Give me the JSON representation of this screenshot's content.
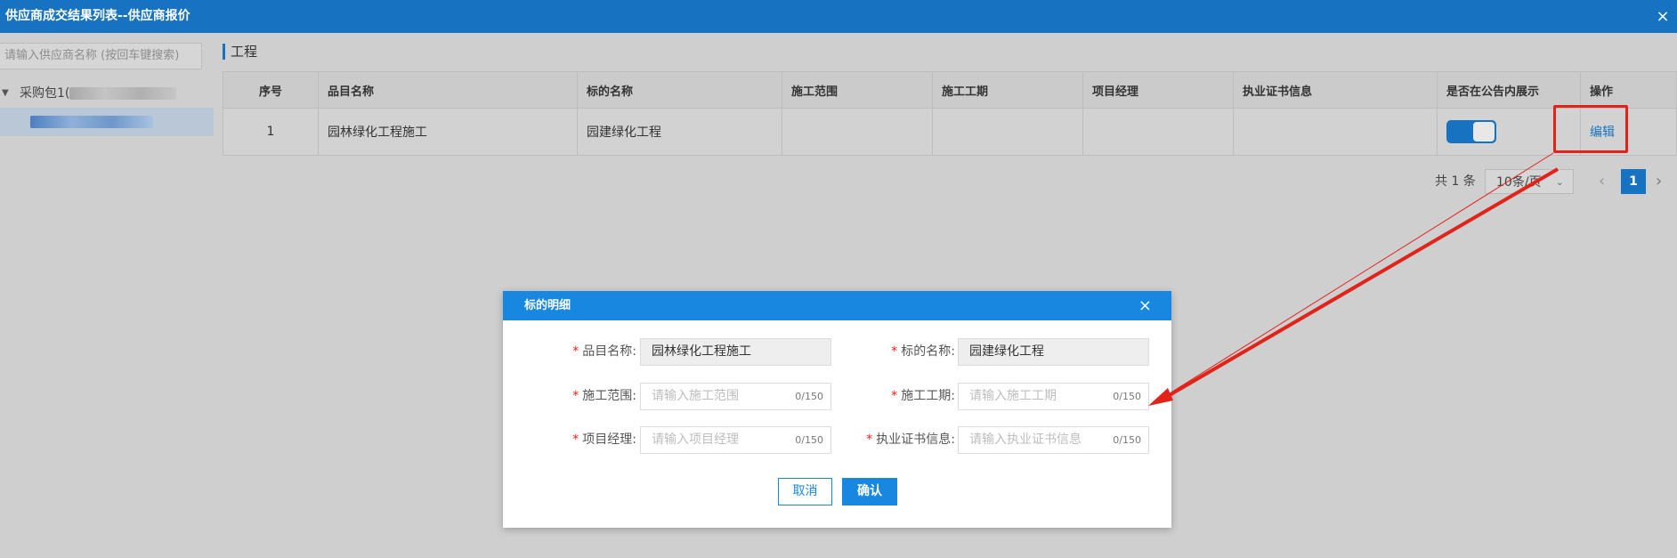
{
  "window": {
    "title": "供应商成交结果列表--供应商报价",
    "close_icon": "×"
  },
  "sidebar": {
    "search_placeholder": "请输入供应商名称 (按回车键搜索)",
    "group_label": "采购包1(",
    "group_arrow": "▼"
  },
  "section": {
    "title": "工程"
  },
  "table": {
    "headers": [
      "序号",
      "品目名称",
      "标的名称",
      "施工范围",
      "施工工期",
      "项目经理",
      "执业证书信息",
      "是否在公告内展示",
      "操作"
    ],
    "rows": [
      {
        "index": "1",
        "item_name": "园林绿化工程施工",
        "target_name": "园建绿化工程",
        "scope": "",
        "period": "",
        "manager": "",
        "cert": "",
        "show_in_notice": true,
        "action": "编辑"
      }
    ]
  },
  "pager": {
    "total": "共 1 条",
    "page_size": "10条/页",
    "page": "1",
    "prev": "‹",
    "next": "›",
    "size_chevron": "⌄"
  },
  "dialog": {
    "title": "标的明细",
    "close": "×",
    "fields": [
      {
        "label": "品目名称:",
        "value": "园林绿化工程施工",
        "placeholder": "",
        "count": ""
      },
      {
        "label": "标的名称:",
        "value": "园建绿化工程",
        "placeholder": "",
        "count": ""
      },
      {
        "label": "施工范围:",
        "value": "",
        "placeholder": "请输入施工范围",
        "count": "0/150"
      },
      {
        "label": "施工工期:",
        "value": "",
        "placeholder": "请输入施工工期",
        "count": "0/150"
      },
      {
        "label": "项目经理:",
        "value": "",
        "placeholder": "请输入项目经理",
        "count": "0/150"
      },
      {
        "label": "执业证书信息:",
        "value": "",
        "placeholder": "请输入执业证书信息",
        "count": "0/150"
      }
    ],
    "required_mark": "*",
    "cancel": "取消",
    "confirm": "确认"
  },
  "colors": {
    "primary": "#1773c1",
    "dialog_header": "#1787e0",
    "annotation": "#e2231a"
  }
}
